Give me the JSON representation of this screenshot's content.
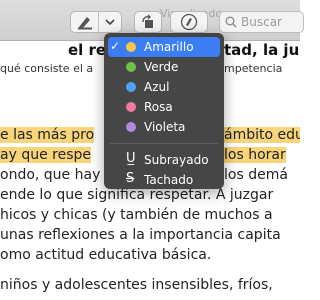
{
  "toolbar": {
    "ghost_text": "Visualizado",
    "search_placeholder": "Buscar",
    "icons": {
      "highlight": "highlighter-pen-icon",
      "chevron": "chevron-down-icon",
      "rotate": "rotate-icon",
      "markup": "markup-pen-circle-icon",
      "search": "search-icon"
    }
  },
  "menu": {
    "items": [
      {
        "label": "Amarillo",
        "color": "#f5c84c",
        "checked": true
      },
      {
        "label": "Verde",
        "color": "#6cc24a",
        "checked": false
      },
      {
        "label": "Azul",
        "color": "#4fa3f7",
        "checked": false
      },
      {
        "label": "Rosa",
        "color": "#f07aa0",
        "checked": false
      },
      {
        "label": "Violeta",
        "color": "#b488e0",
        "checked": false
      }
    ],
    "styles": [
      {
        "label": "Subrayado",
        "glyph": "U̲"
      },
      {
        "label": "Tachado",
        "glyph": "S̶"
      }
    ]
  },
  "document": {
    "heading_left": "el re",
    "heading_right": "tad, la ju",
    "sub_left": "qué consiste el a",
    "sub_right": "mpetencia",
    "lines": [
      {
        "left": "e las más pro",
        "right": "ámbito edu",
        "highlight": true
      },
      {
        "left": "ay que respe",
        "right": "los horar",
        "highlight": true
      },
      {
        "left": "ondo, que hay",
        "right": "los demá",
        "highlight": true
      },
      {
        "left": "ende lo que significa respetar. A juzgar",
        "right": "",
        "highlight": false
      },
      {
        "left": "hicos y chicas (y también de muchos a",
        "right": "",
        "highlight": false
      },
      {
        "left": "unas reflexiones a la importancia capita",
        "right": "",
        "highlight": false
      },
      {
        "left": "omo actitud educativa básica.",
        "right": "",
        "highlight": false
      },
      {
        "left": "niños y adolescentes insensibles, fríos,",
        "right": "",
        "highlight": false
      }
    ]
  }
}
